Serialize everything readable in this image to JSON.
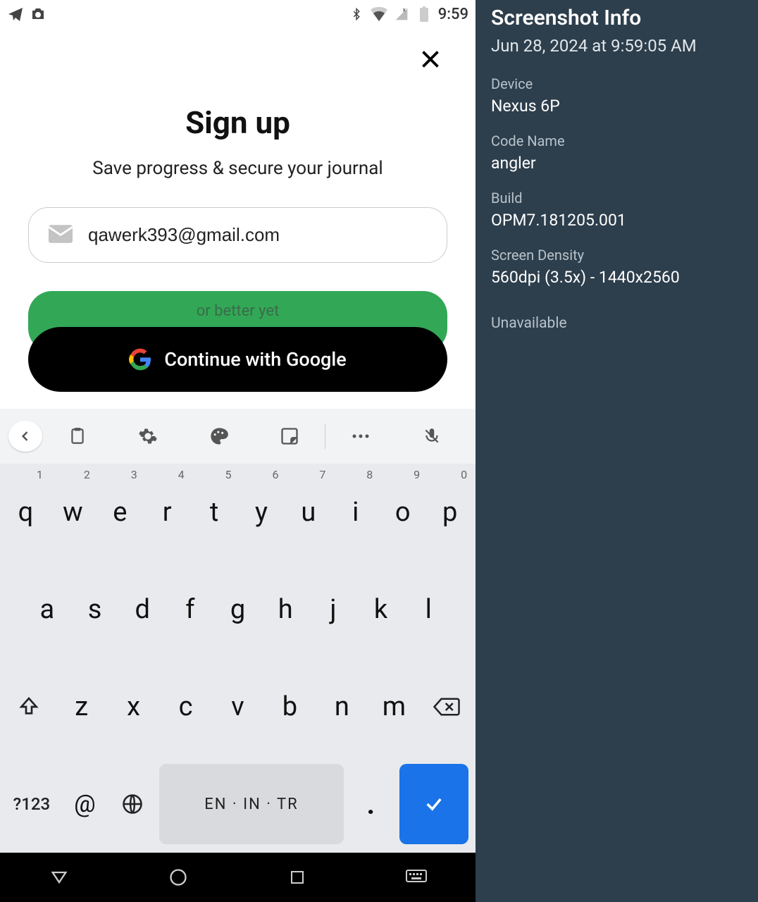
{
  "statusbar": {
    "time": "9:59",
    "left_icons": [
      "telegram",
      "camera"
    ],
    "right_icons": [
      "bluetooth",
      "wifi",
      "cell-no-signal",
      "battery"
    ]
  },
  "signup": {
    "title": "Sign up",
    "subtitle": "Save progress & secure your journal",
    "email_value": "qawerk393@gmail.com",
    "email_placeholder": "Email",
    "or_better": "or better yet",
    "continue_google": "Continue with Google"
  },
  "keyboard": {
    "toolbar_icons": [
      "chevron-left",
      "clipboard",
      "gear",
      "palette",
      "sticker",
      "more",
      "mic-off"
    ],
    "row1": [
      {
        "k": "q",
        "alt": "1"
      },
      {
        "k": "w",
        "alt": "2"
      },
      {
        "k": "e",
        "alt": "3"
      },
      {
        "k": "r",
        "alt": "4"
      },
      {
        "k": "t",
        "alt": "5"
      },
      {
        "k": "y",
        "alt": "6"
      },
      {
        "k": "u",
        "alt": "7"
      },
      {
        "k": "i",
        "alt": "8"
      },
      {
        "k": "o",
        "alt": "9"
      },
      {
        "k": "p",
        "alt": "0"
      }
    ],
    "row2": [
      "a",
      "s",
      "d",
      "f",
      "g",
      "h",
      "j",
      "k",
      "l"
    ],
    "row3": [
      "z",
      "x",
      "c",
      "v",
      "b",
      "n",
      "m"
    ],
    "numkey": "?123",
    "at": "@",
    "dot": ".",
    "space_label": "EN · IN · TR"
  },
  "navbar": {
    "items": [
      "back",
      "home",
      "recent",
      "keyboard"
    ]
  },
  "info": {
    "title": "Screenshot Info",
    "timestamp": "Jun 28, 2024 at 9:59:05 AM",
    "device_label": "Device",
    "device": "Nexus 6P",
    "codename_label": "Code Name",
    "codename": "angler",
    "build_label": "Build",
    "build": "OPM7.181205.001",
    "density_label": "Screen Density",
    "density": "560dpi (3.5x) - 1440x2560",
    "unavailable": "Unavailable"
  }
}
